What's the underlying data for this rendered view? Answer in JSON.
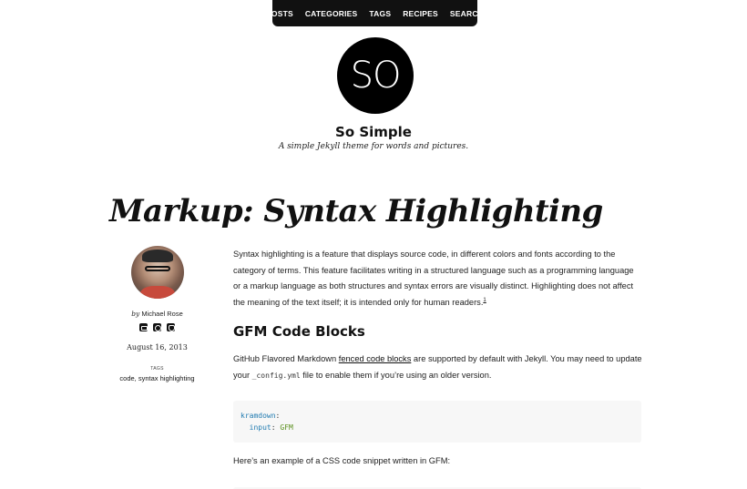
{
  "nav": {
    "items": [
      "POSTS",
      "CATEGORIES",
      "TAGS",
      "RECIPES",
      "SEARCH"
    ]
  },
  "site": {
    "logo_text": "SO",
    "title": "So Simple",
    "description": "A simple Jekyll theme for words and pictures."
  },
  "post": {
    "title": "Markup: Syntax Highlighting",
    "author_prefix": "by",
    "author": "Michael Rose",
    "social_icons": [
      "twitter-icon",
      "instagram-icon",
      "github-icon"
    ],
    "date": "August 16, 2013",
    "tags_label": "TAGS",
    "tags": "code, syntax highlighting",
    "intro": "Syntax highlighting is a feature that displays source code, in different colors and fonts according to the category of terms. This feature facilitates writing in a structured language such as a programming language or a markup language as both structures and syntax errors are visually distinct. Highlighting does not affect the meaning of the text itself; it is intended only for human readers.",
    "footnote_ref": "1",
    "section_heading": "GFM Code Blocks",
    "p2_before": "GitHub Flavored Markdown ",
    "p2_link": "fenced code blocks",
    "p2_middle": " are supported by default with Jekyll. You may need to update your ",
    "p2_code": "_config.yml",
    "p2_after": " file to enable them if you’re using an older version.",
    "code": {
      "line1_key": "kramdown",
      "line1_colon": ":",
      "line2_key": "input",
      "line2_colon": ": ",
      "line2_value": "GFM"
    },
    "p3": "Here’s an example of a CSS code snippet written in GFM:"
  },
  "colors": {
    "nav_bg": "#111111",
    "code_key": "#1f7ab0",
    "code_value": "#5a8f1c",
    "code_bg": "#f7f7f7"
  }
}
